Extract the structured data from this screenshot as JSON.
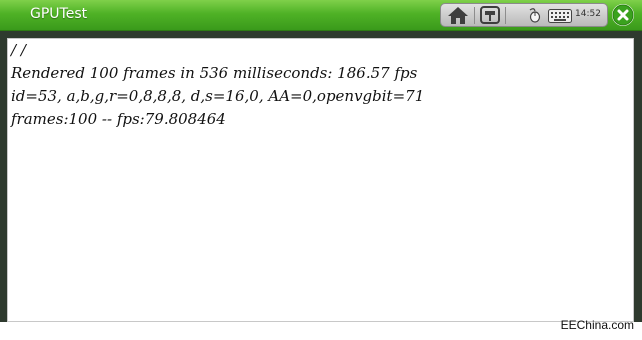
{
  "window": {
    "title": "GPUTest",
    "clock": "14:52"
  },
  "tray": {
    "icons": [
      "home-icon",
      "window-switch-icon",
      "mouse-icon",
      "keyboard-icon"
    ],
    "close_icon": "close-icon"
  },
  "colors": {
    "titlebar": "#4fb226",
    "close_button": "#3aa21e"
  },
  "output": {
    "lines": [
      "/ /",
      "Rendered 100 frames in 536 milliseconds: 186.57 fps",
      "id=53, a,b,g,r=0,8,8,8, d,s=16,0, AA=0,openvgbit=71",
      "frames:100 -- fps:79.808464"
    ]
  },
  "watermark": "EEChina.com"
}
